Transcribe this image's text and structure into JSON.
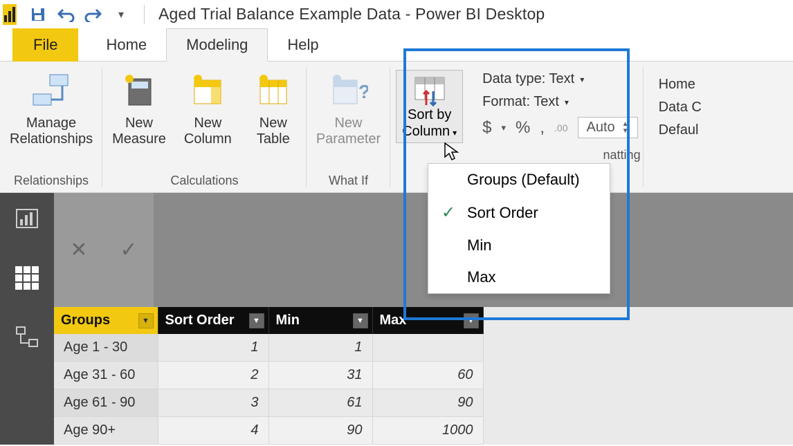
{
  "title": "Aged Trial Balance Example Data - Power BI Desktop",
  "tabs": {
    "file": "File",
    "home": "Home",
    "modeling": "Modeling",
    "help": "Help"
  },
  "ribbon": {
    "relationships": {
      "manage": "Manage\nRelationships",
      "group": "Relationships"
    },
    "calculations": {
      "newMeasure": "New\nMeasure",
      "newColumn": "New\nColumn",
      "newTable": "New\nTable",
      "group": "Calculations"
    },
    "whatif": {
      "newParam": "New\nParameter",
      "group": "What If"
    },
    "sort": {
      "label": "Sort by\nColumn",
      "menu": {
        "groups": "Groups (Default)",
        "sortOrder": "Sort Order",
        "min": "Min",
        "max": "Max"
      }
    },
    "formatting": {
      "dataType": "Data type: Text",
      "format": "Format: Text",
      "auto": "Auto",
      "group": "natting"
    },
    "properties": {
      "homeTable": "Home ",
      "dataCat": "Data C",
      "defaultSumm": "Defaul"
    }
  },
  "grid": {
    "headers": {
      "groups": "Groups",
      "sortOrder": "Sort Order",
      "min": "Min",
      "max": "Max"
    },
    "rows": [
      {
        "g": "Age 1 - 30",
        "s": "1",
        "min": "1",
        "max": ""
      },
      {
        "g": "Age 31 - 60",
        "s": "2",
        "min": "31",
        "max": "60"
      },
      {
        "g": "Age 61 - 90",
        "s": "3",
        "min": "61",
        "max": "90"
      },
      {
        "g": "Age 90+",
        "s": "4",
        "min": "90",
        "max": "1000"
      }
    ]
  }
}
